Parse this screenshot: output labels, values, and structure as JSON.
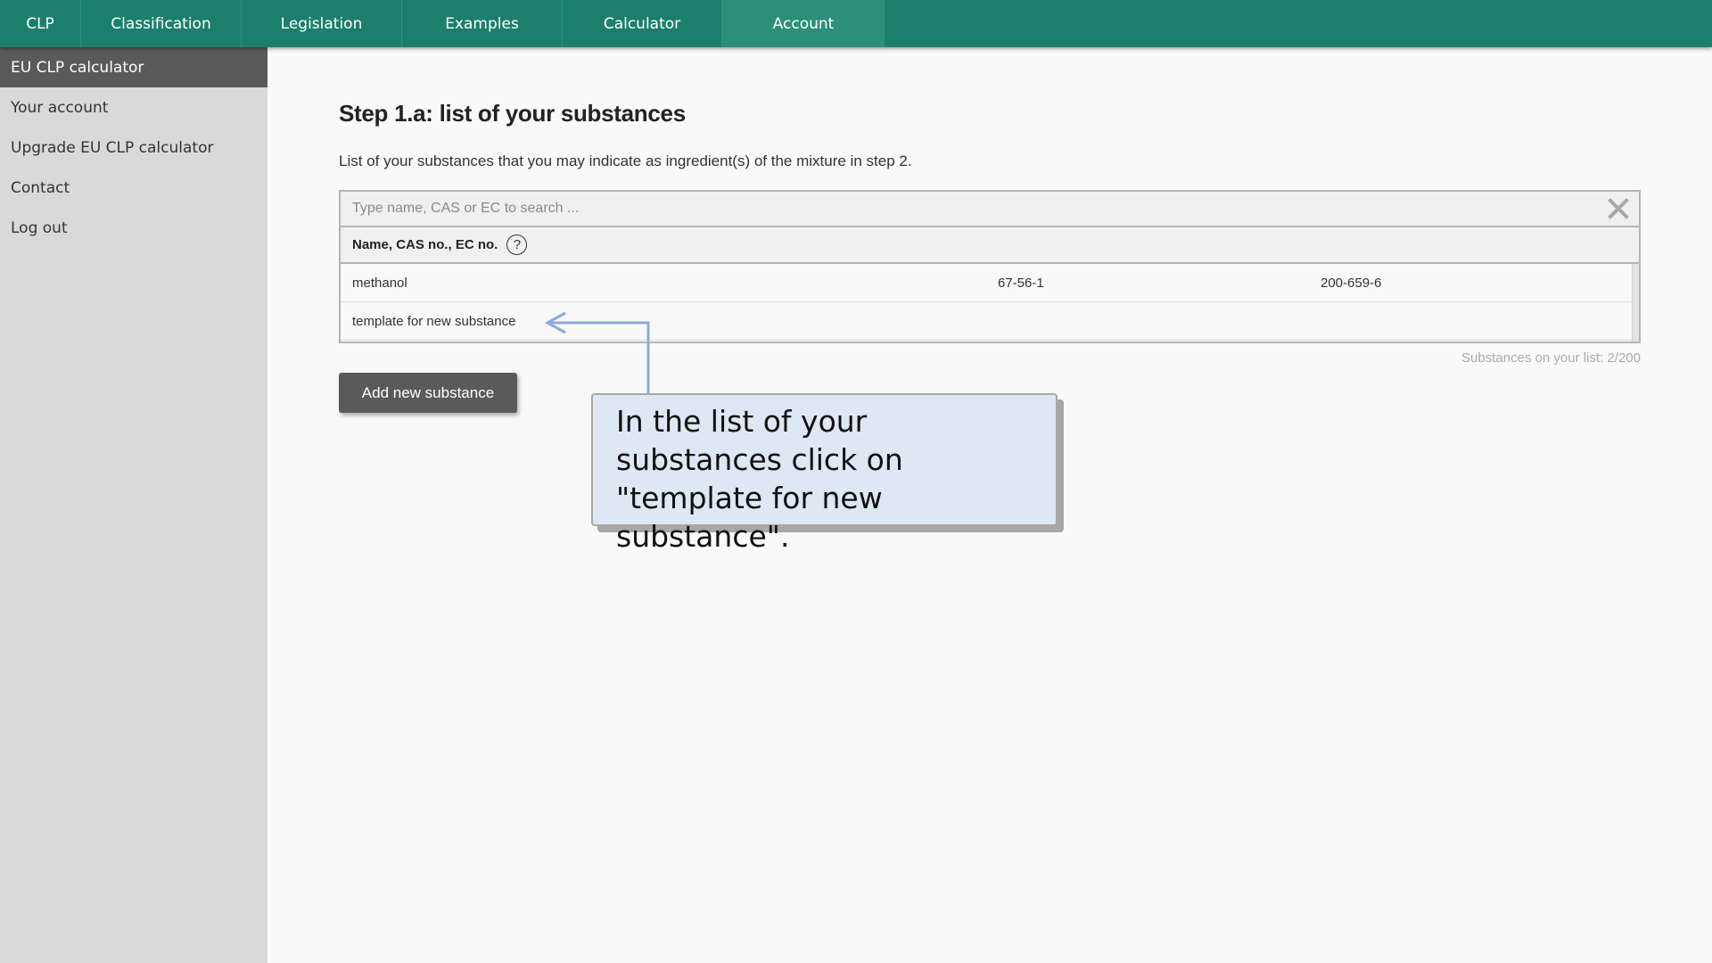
{
  "topnav": {
    "tabs": [
      {
        "label": "CLP",
        "active": false
      },
      {
        "label": "Classification",
        "active": false
      },
      {
        "label": "Legislation",
        "active": false
      },
      {
        "label": "Examples",
        "active": false
      },
      {
        "label": "Calculator",
        "active": false
      },
      {
        "label": "Account",
        "active": true
      }
    ]
  },
  "sidebar": {
    "items": [
      {
        "label": "EU CLP calculator",
        "active": true
      },
      {
        "label": "Your account",
        "active": false
      },
      {
        "label": "Upgrade EU CLP calculator",
        "active": false
      },
      {
        "label": "Contact",
        "active": false
      },
      {
        "label": "Log out",
        "active": false
      }
    ]
  },
  "main": {
    "title": "Step 1.a:  list of your substances",
    "intro": "List of your substances that you may indicate as ingredient(s) of the mixture in step 2.",
    "search": {
      "placeholder": "Type name, CAS or EC to search ...",
      "value": ""
    },
    "table": {
      "header": "Name, CAS no., EC no.",
      "help_icon": "?",
      "rows": [
        {
          "name": "methanol",
          "cas": "67-56-1",
          "ec": "200-659-6"
        },
        {
          "name": "template for new substance",
          "cas": "",
          "ec": ""
        }
      ]
    },
    "count_label": "Substances on your list: 2/200",
    "add_button": "Add new substance"
  },
  "callout": {
    "text": "In the list of your substances click on \"template for new substance\".",
    "arrow_color": "#8eaadb",
    "background": "#dde8f4"
  },
  "colors": {
    "nav": "#1c7f6d",
    "nav_active": "#2c8f7c",
    "sidebar_active": "#5a5a5a",
    "sidebar_bg": "#d9d9d9"
  }
}
